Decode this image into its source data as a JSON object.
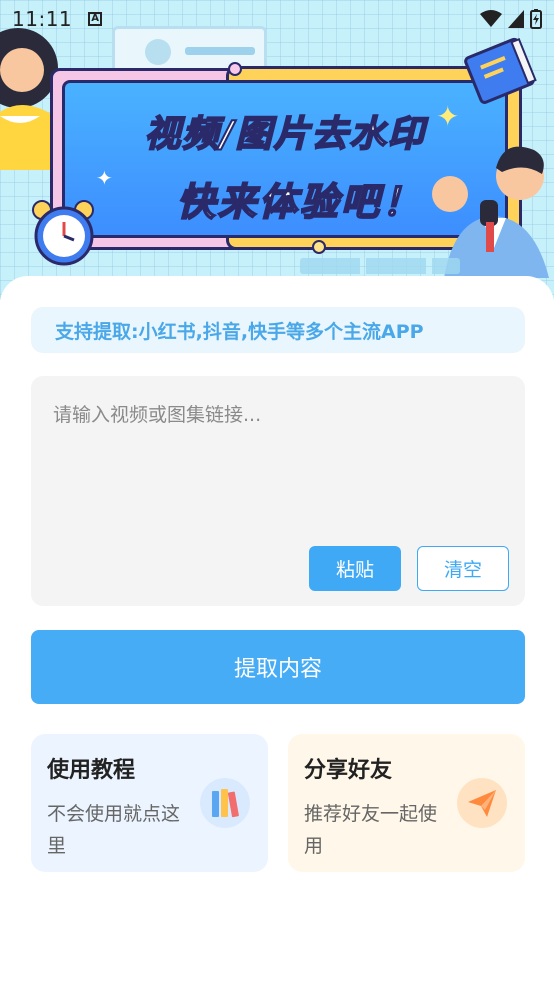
{
  "status_bar": {
    "time": "11:11",
    "indicator": "A"
  },
  "banner": {
    "line1": "视频/图片去水印",
    "line2": "快来体验吧！"
  },
  "support_text": "支持提取:小红书,抖音,快手等多个主流APP",
  "input": {
    "placeholder": "请输入视频或图集链接...",
    "value": ""
  },
  "buttons": {
    "paste": "粘贴",
    "clear": "清空",
    "extract": "提取内容"
  },
  "features": [
    {
      "title": "使用教程",
      "desc": "不会使用就点这里",
      "icon": "books-icon"
    },
    {
      "title": "分享好友",
      "desc": "推荐好友一起使用",
      "icon": "paper-plane-icon"
    }
  ],
  "colors": {
    "accent": "#46acf6",
    "banner_blue": "#3d8eff",
    "pill_text": "#4aa8e8"
  }
}
